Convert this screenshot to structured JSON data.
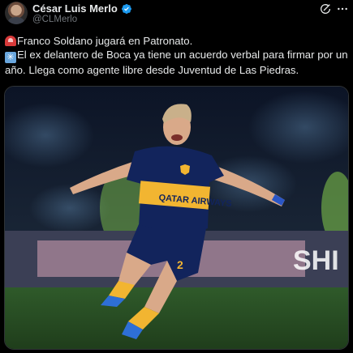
{
  "author": {
    "display_name": "César Luis Merlo",
    "handle": "@CLMerlo",
    "verified": true
  },
  "icons": {
    "avatar": "avatar",
    "verified": "verified-badge-icon",
    "grok": "grok-icon",
    "more": "more-icon",
    "siren": "siren-emoji",
    "asterisk": "asterisk-emoji"
  },
  "tweet": {
    "line1": "Franco Soldano jugará en Patronato.",
    "line2": "El ex delantero de Boca ya tiene un acuerdo verbal para firmar por un año. Llega como agente libre desde Juventud de Las Piedras."
  },
  "media": {
    "jersey_text": "QATAR AIRWAYS",
    "banner_text": "SHI",
    "jersey_number": "2"
  },
  "colors": {
    "background": "#000000",
    "verified_blue": "#1d9bf0",
    "handle_gray": "#71767b",
    "boca_blue": "#12245c",
    "boca_yellow": "#f2b531"
  }
}
